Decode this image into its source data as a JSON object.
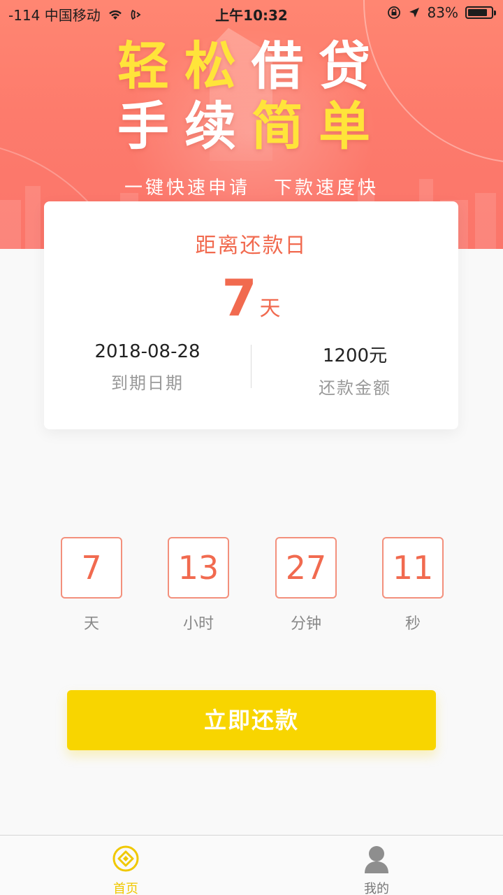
{
  "status_bar": {
    "carrier": "-114 中国移动",
    "time": "上午10:32",
    "battery_percent": "83%",
    "battery_level": 0.83
  },
  "banner": {
    "slogan_line1_a": "轻松",
    "slogan_line1_b": "借贷",
    "slogan_line2_a": "手续",
    "slogan_line2_b": "简单",
    "sub_left": "一键快速申请",
    "sub_right": "下款速度快"
  },
  "card": {
    "title": "距离还款日",
    "days_value": "7",
    "days_unit": "天",
    "due_date": "2018-08-28",
    "due_date_label": "到期日期",
    "amount": "1200元",
    "amount_label": "还款金额"
  },
  "countdown": [
    {
      "value": "7",
      "label": "天"
    },
    {
      "value": "13",
      "label": "小时"
    },
    {
      "value": "27",
      "label": "分钟"
    },
    {
      "value": "11",
      "label": "秒"
    }
  ],
  "repay_button": {
    "label": "立即还款"
  },
  "tabbar": {
    "home_label": "首页",
    "home_icon": "coin-icon",
    "mine_label": "我的",
    "mine_icon": "user-icon"
  },
  "colors": {
    "accent": "#f16a4f",
    "button": "#f8d500",
    "banner": "#fb756a"
  }
}
